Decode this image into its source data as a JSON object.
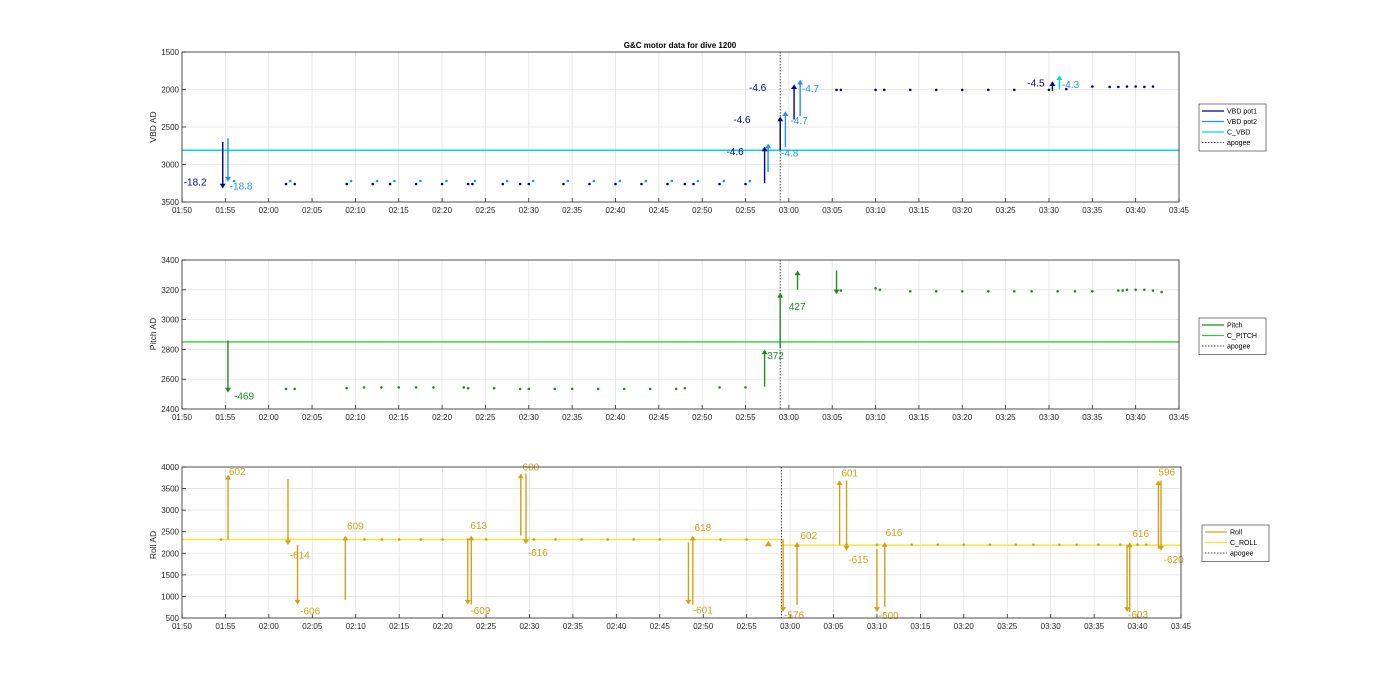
{
  "chart_data": [
    {
      "type": "line",
      "title": "G&C motor data for dive 1200",
      "ylabel": "VBD AD",
      "xlim": [
        "01:50",
        "03:45"
      ],
      "ylim": [
        3500,
        1500
      ],
      "y_reversed": true,
      "xticks": [
        "01:50",
        "01:55",
        "02:00",
        "02:05",
        "02:10",
        "02:15",
        "02:20",
        "02:25",
        "02:30",
        "02:35",
        "02:40",
        "02:45",
        "02:50",
        "02:55",
        "03:00",
        "03:05",
        "03:10",
        "03:15",
        "03:20",
        "03:25",
        "03:30",
        "03:35",
        "03:40",
        "03:45"
      ],
      "yticks": [
        1500,
        2000,
        2500,
        3000,
        3500
      ],
      "grid": true,
      "legend_position": "right",
      "legend": [
        {
          "name": "VBD pot1",
          "color": "#00008b",
          "style": "solid"
        },
        {
          "name": "VBD pot2",
          "color": "#1e90ff",
          "style": "solid"
        },
        {
          "name": "C_VBD",
          "color": "#00d8e0",
          "style": "solid"
        },
        {
          "name": "apogee",
          "color": "#444444",
          "style": "dotted"
        }
      ],
      "apogee_x": "02:59",
      "series": [
        {
          "name": "VBD pot1",
          "color": "#00008b",
          "x": [
            "02:02",
            "02:03",
            "02:09",
            "02:12",
            "02:14",
            "02:17",
            "02:20",
            "02:23",
            "02:23.5",
            "02:27",
            "02:29",
            "02:30",
            "02:34",
            "02:37",
            "02:40",
            "02:43",
            "02:46",
            "02:48",
            "02:49",
            "02:52",
            "02:55",
            "03:05.5",
            "03:06",
            "03:10",
            "03:11",
            "03:14",
            "03:17",
            "03:20",
            "03:23",
            "03:26",
            "03:30",
            "03:32",
            "03:35",
            "03:37",
            "03:38",
            "03:39",
            "03:40",
            "03:41",
            "03:42"
          ],
          "y": [
            3260,
            3260,
            3260,
            3260,
            3260,
            3260,
            3260,
            3260,
            3260,
            3260,
            3260,
            3260,
            3260,
            3260,
            3260,
            3260,
            3260,
            3260,
            3260,
            3260,
            3260,
            2005,
            2005,
            2005,
            2005,
            2005,
            2005,
            2005,
            2005,
            2005,
            2005,
            1995,
            1960,
            1965,
            1965,
            1960,
            1960,
            1965,
            1960
          ]
        },
        {
          "name": "VBD pot2",
          "color": "#1e90ff",
          "x": [
            "01:56",
            "02:02.5",
            "02:09.5",
            "02:12.5",
            "02:14.5",
            "02:17.5",
            "02:20.5",
            "02:23.8",
            "02:27.5",
            "02:30.5",
            "02:34.5",
            "02:37.5",
            "02:40.5",
            "02:43.5",
            "02:46.5",
            "02:49.5",
            "02:52.5",
            "02:55.5"
          ],
          "y": [
            3220,
            3220,
            3220,
            3220,
            3220,
            3220,
            3220,
            3220,
            3220,
            3220,
            3220,
            3220,
            3220,
            3220,
            3220,
            3220,
            3220,
            3220
          ]
        },
        {
          "name": "C_VBD",
          "color": "#00d8e0",
          "constant_y": 2810
        }
      ],
      "arrows": [
        {
          "x": "01:54.7",
          "from": 2700,
          "to": 3320,
          "color": "#00008b"
        },
        {
          "x": "01:55.3",
          "from": 2650,
          "to": 3230,
          "color": "#1e90ff"
        },
        {
          "x": "02:57.2",
          "from": 3250,
          "to": 2760,
          "color": "#00008b"
        },
        {
          "x": "02:57.6",
          "from": 3100,
          "to": 2720,
          "color": "#1e90ff"
        },
        {
          "x": "02:59.0",
          "from": 2810,
          "to": 2360,
          "color": "#00008b"
        },
        {
          "x": "02:59.6",
          "from": 2770,
          "to": 2290,
          "color": "#1e90ff"
        },
        {
          "x": "03:00.6",
          "from": 2400,
          "to": 1930,
          "color": "#00008b"
        },
        {
          "x": "03:01.3",
          "from": 2350,
          "to": 1870,
          "color": "#1e90ff"
        },
        {
          "x": "03:30.4",
          "from": 2020,
          "to": 1890,
          "color": "#00008b"
        },
        {
          "x": "03:31.2",
          "from": 1990,
          "to": 1810,
          "color": "#00d8e0"
        }
      ],
      "annotations": [
        {
          "text": "-18.2",
          "x": "01:50.2",
          "y": 3280,
          "color": "#00008b"
        },
        {
          "text": "-18.8",
          "x": "01:55.5",
          "y": 3335,
          "color": "#1e90ff"
        },
        {
          "text": "-4.6",
          "x": "02:52.8",
          "y": 2870,
          "color": "#00008b"
        },
        {
          "text": "-4.8",
          "x": "02:59.1",
          "y": 2890,
          "color": "#1e90ff"
        },
        {
          "text": "-4.6",
          "x": "02:53.6",
          "y": 2445,
          "color": "#00008b"
        },
        {
          "text": "-4.7",
          "x": "03:00.2",
          "y": 2460,
          "color": "#1e90ff"
        },
        {
          "text": "-4.6",
          "x": "02:55.4",
          "y": 2020,
          "color": "#00008b"
        },
        {
          "text": "-4.7",
          "x": "03:01.5",
          "y": 2030,
          "color": "#1e90ff"
        },
        {
          "text": "-4.5",
          "x": "03:27.5",
          "y": 1960,
          "color": "#00008b"
        },
        {
          "text": "-4.3",
          "x": "03:31.5",
          "y": 1980,
          "color": "#1e90ff"
        }
      ]
    },
    {
      "type": "line",
      "ylabel": "Pitch AD",
      "xlim": [
        "01:50",
        "03:45"
      ],
      "ylim": [
        2400,
        3400
      ],
      "xticks": [
        "01:50",
        "01:55",
        "02:00",
        "02:05",
        "02:10",
        "02:15",
        "02:20",
        "02:25",
        "02:30",
        "02:35",
        "02:40",
        "02:45",
        "02:50",
        "02:55",
        "03:00",
        "03:05",
        "03:10",
        "03:15",
        "03:20",
        "03:25",
        "03:30",
        "03:35",
        "03:40",
        "03:45"
      ],
      "yticks": [
        2400,
        2600,
        2800,
        3000,
        3200,
        3400
      ],
      "grid": true,
      "legend_position": "right",
      "legend": [
        {
          "name": "Pitch",
          "color": "#228b22",
          "style": "solid"
        },
        {
          "name": "C_PITCH",
          "color": "#32cd32",
          "style": "solid"
        },
        {
          "name": "apogee",
          "color": "#444444",
          "style": "dotted"
        }
      ],
      "apogee_x": "02:59",
      "series": [
        {
          "name": "Pitch",
          "color": "#228b22",
          "x": [
            "02:02",
            "02:03",
            "02:09",
            "02:11",
            "02:13",
            "02:15",
            "02:17",
            "02:19",
            "02:22.5",
            "02:23",
            "02:26",
            "02:29",
            "02:30",
            "02:33",
            "02:35",
            "02:38",
            "02:41",
            "02:44",
            "02:47",
            "02:48",
            "02:52",
            "02:55",
            "03:06",
            "03:10",
            "03:10.5",
            "03:14",
            "03:17",
            "03:20",
            "03:23",
            "03:26",
            "03:28",
            "03:31",
            "03:33",
            "03:35",
            "03:38",
            "03:38.5",
            "03:39",
            "03:40",
            "03:41",
            "03:42",
            "03:43"
          ],
          "y": [
            2535,
            2535,
            2540,
            2545,
            2545,
            2545,
            2545,
            2545,
            2545,
            2540,
            2540,
            2535,
            2535,
            2535,
            2535,
            2535,
            2535,
            2535,
            2535,
            2540,
            2545,
            2545,
            3195,
            3210,
            3200,
            3190,
            3190,
            3190,
            3190,
            3190,
            3190,
            3190,
            3190,
            3190,
            3195,
            3195,
            3200,
            3200,
            3200,
            3195,
            3185
          ]
        },
        {
          "name": "C_PITCH",
          "color": "#32cd32",
          "constant_y": 2850
        }
      ],
      "arrows": [
        {
          "x": "01:55.3",
          "from": 2860,
          "to": 2510,
          "color": "#228b22"
        },
        {
          "x": "02:57.2",
          "from": 2550,
          "to": 2800,
          "color": "#228b22"
        },
        {
          "x": "02:59.0",
          "from": 2810,
          "to": 3180,
          "color": "#228b22"
        },
        {
          "x": "03:01.0",
          "from": 3200,
          "to": 3330,
          "color": "#228b22"
        },
        {
          "x": "03:05.5",
          "from": 3330,
          "to": 3170,
          "color": "#228b22"
        }
      ],
      "annotations": [
        {
          "text": "-469",
          "x": "01:56",
          "y": 2465,
          "color": "#228b22"
        },
        {
          "text": "372",
          "x": "02:57.5",
          "y": 2735,
          "color": "#228b22"
        },
        {
          "text": "427",
          "x": "03:00",
          "y": 3065,
          "color": "#228b22"
        }
      ]
    },
    {
      "type": "line",
      "ylabel": "Roll AD",
      "xlim": [
        "01:50",
        "03:45"
      ],
      "ylim": [
        500,
        4000
      ],
      "xticks": [
        "01:50",
        "01:55",
        "02:00",
        "02:05",
        "02:10",
        "02:15",
        "02:20",
        "02:25",
        "02:30",
        "02:35",
        "02:40",
        "02:45",
        "02:50",
        "02:55",
        "03:00",
        "03:05",
        "03:10",
        "03:15",
        "03:20",
        "03:25",
        "03:30",
        "03:35",
        "03:40",
        "03:45"
      ],
      "yticks": [
        500,
        1000,
        1500,
        2000,
        2500,
        3000,
        3500,
        4000
      ],
      "grid": true,
      "legend_position": "right",
      "legend": [
        {
          "name": "Roll",
          "color": "#d4a017",
          "style": "solid"
        },
        {
          "name": "C_ROLL",
          "color": "#f5e431",
          "style": "solid"
        },
        {
          "name": "apogee",
          "color": "#444444",
          "style": "dotted"
        }
      ],
      "apogee_x": "02:59",
      "series": [
        {
          "name": "Roll",
          "color": "#d4a017",
          "x": [
            "01:54.5",
            "02:11",
            "02:13",
            "02:15",
            "02:17.5",
            "02:20",
            "02:25",
            "02:30.5",
            "02:33",
            "02:36",
            "02:39",
            "02:42",
            "02:45",
            "02:52",
            "02:55",
            "03:06.5",
            "03:10",
            "03:14",
            "03:17",
            "03:20",
            "03:23",
            "03:26",
            "03:28",
            "03:31",
            "03:33",
            "03:35.5",
            "03:38",
            "03:40",
            "03:41"
          ],
          "y": [
            2320,
            2320,
            2320,
            2320,
            2320,
            2320,
            2320,
            2320,
            2320,
            2320,
            2320,
            2320,
            2320,
            2320,
            2320,
            2200,
            2200,
            2200,
            2200,
            2200,
            2200,
            2200,
            2200,
            2200,
            2200,
            2200,
            2200,
            2200,
            2200
          ]
        },
        {
          "name": "C_ROLL",
          "color": "#f5e431",
          "segments": [
            {
              "x0": "01:50",
              "x1": "02:59",
              "y": 2320
            },
            {
              "x0": "02:59",
              "x1": "03:45",
              "y": 2190
            }
          ]
        }
      ],
      "arrows": [
        {
          "x": "01:55.3",
          "from": 2320,
          "to": 3820,
          "color": "#d4a017"
        },
        {
          "x": "02:02.2",
          "from": 3720,
          "to": 2190,
          "color": "#d4a017"
        },
        {
          "x": "02:03.3",
          "from": 2190,
          "to": 810,
          "color": "#d4a017"
        },
        {
          "x": "02:08.8",
          "from": 920,
          "to": 2410,
          "color": "#d4a017"
        },
        {
          "x": "02:22.9",
          "from": 2350,
          "to": 810,
          "color": "#d4a017"
        },
        {
          "x": "02:23.3",
          "from": 810,
          "to": 2410,
          "color": "#d4a017"
        },
        {
          "x": "02:29.0",
          "from": 2410,
          "to": 3850,
          "color": "#d4a017"
        },
        {
          "x": "02:29.6",
          "from": 3850,
          "to": 2210,
          "color": "#d4a017"
        },
        {
          "x": "02:48.3",
          "from": 2250,
          "to": 810,
          "color": "#d4a017"
        },
        {
          "x": "02:48.8",
          "from": 810,
          "to": 2410,
          "color": "#d4a017"
        },
        {
          "x": "02:59.2",
          "from": 2330,
          "to": 640,
          "color": "#d4a017"
        },
        {
          "x": "03:00.8",
          "from": 800,
          "to": 2260,
          "color": "#d4a017"
        },
        {
          "x": "03:05.7",
          "from": 2200,
          "to": 3690,
          "color": "#d4a017"
        },
        {
          "x": "03:06.5",
          "from": 3690,
          "to": 2060,
          "color": "#d4a017"
        },
        {
          "x": "03:10.0",
          "from": 2100,
          "to": 640,
          "color": "#d4a017"
        },
        {
          "x": "03:10.9",
          "from": 760,
          "to": 2260,
          "color": "#d4a017"
        },
        {
          "x": "03:38.8",
          "from": 2200,
          "to": 640,
          "color": "#d4a017"
        },
        {
          "x": "03:39.1",
          "from": 640,
          "to": 2250,
          "color": "#d4a017"
        },
        {
          "x": "03:42.4",
          "from": 2100,
          "to": 3690,
          "color": "#d4a017"
        },
        {
          "x": "03:42.7",
          "from": 3690,
          "to": 2060,
          "color": "#d4a017"
        }
      ],
      "markers": [
        {
          "x": "02:57.5",
          "y": 2220,
          "color": "#d4a017"
        }
      ],
      "annotations": [
        {
          "text": "602",
          "x": "01:55.4",
          "y": 3820,
          "color": "#d4a017"
        },
        {
          "text": "-614",
          "x": "02:02.4",
          "y": 1880,
          "color": "#d4a017"
        },
        {
          "text": "-606",
          "x": "02:03.6",
          "y": 580,
          "color": "#d4a017"
        },
        {
          "text": "609",
          "x": "02:09",
          "y": 2550,
          "color": "#d4a017"
        },
        {
          "text": "613",
          "x": "02:23.2",
          "y": 2560,
          "color": "#d4a017"
        },
        {
          "text": "-609",
          "x": "02:23.2",
          "y": 590,
          "color": "#d4a017"
        },
        {
          "text": "600",
          "x": "02:29.2",
          "y": 3920,
          "color": "#d4a017"
        },
        {
          "text": "-616",
          "x": "02:29.8",
          "y": 1940,
          "color": "#d4a017"
        },
        {
          "text": "618",
          "x": "02:49",
          "y": 2520,
          "color": "#d4a017"
        },
        {
          "text": "-601",
          "x": "02:48.8",
          "y": 600,
          "color": "#d4a017"
        },
        {
          "text": "-576",
          "x": "02:59.3",
          "y": 490,
          "color": "#d4a017"
        },
        {
          "text": "602",
          "x": "03:01.2",
          "y": 2330,
          "color": "#d4a017"
        },
        {
          "text": "601",
          "x": "03:05.9",
          "y": 3780,
          "color": "#d4a017"
        },
        {
          "text": "-615",
          "x": "03:06.7",
          "y": 1780,
          "color": "#d4a017"
        },
        {
          "text": "-600",
          "x": "03:10.2",
          "y": 480,
          "color": "#d4a017"
        },
        {
          "text": "616",
          "x": "03:11.0",
          "y": 2400,
          "color": "#d4a017"
        },
        {
          "text": "616",
          "x": "03:39.4",
          "y": 2380,
          "color": "#d4a017"
        },
        {
          "text": "-603",
          "x": "03:38.9",
          "y": 500,
          "color": "#d4a017"
        },
        {
          "text": "596",
          "x": "03:42.4",
          "y": 3800,
          "color": "#d4a017"
        },
        {
          "text": "-620",
          "x": "03:43.0",
          "y": 1780,
          "color": "#d4a017"
        }
      ]
    }
  ]
}
